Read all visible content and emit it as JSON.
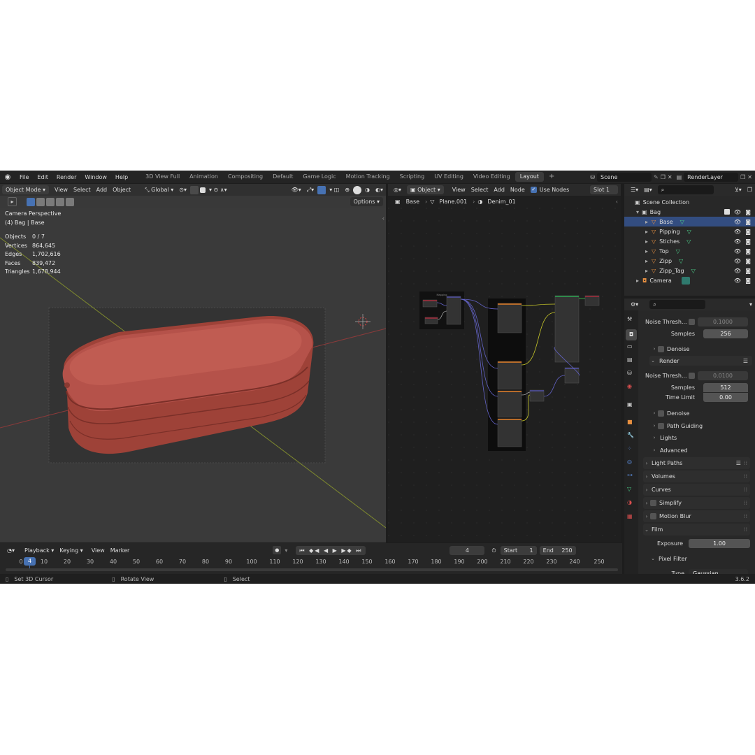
{
  "app": {
    "version": "3.6.2"
  },
  "topbar": {
    "menus": [
      "File",
      "Edit",
      "Render",
      "Window",
      "Help"
    ],
    "workspaces": [
      "3D View Full",
      "Animation",
      "Compositing",
      "Default",
      "Game Logic",
      "Motion Tracking",
      "Scripting",
      "UV Editing",
      "Video Editing",
      "Layout"
    ],
    "active_workspace": "Layout",
    "add": "+",
    "scene": "Scene",
    "view_layer": "RenderLayer"
  },
  "viewport": {
    "mode": "Object Mode",
    "menus": [
      "View",
      "Select",
      "Add",
      "Object"
    ],
    "transform": "Global",
    "options": "Options",
    "overlay": {
      "title": "Camera Perspective",
      "subtitle": "(4) Bag | Base",
      "stats": [
        {
          "label": "Objects",
          "value": "0 / 7"
        },
        {
          "label": "Vertices",
          "value": "864,645"
        },
        {
          "label": "Edges",
          "value": "1,702,616"
        },
        {
          "label": "Faces",
          "value": "839,472"
        },
        {
          "label": "Triangles",
          "value": "1,678,944"
        }
      ]
    },
    "object_color": "#b5524a"
  },
  "node_editor": {
    "type": "Object",
    "menus": [
      "View",
      "Select",
      "Add",
      "Node"
    ],
    "use_nodes": "Use Nodes",
    "slot": "Slot 1",
    "breadcrumb": [
      "Base",
      "Plane.001",
      "Denim_01"
    ],
    "frame_label": "Mapping"
  },
  "outliner": {
    "root": "Scene Collection",
    "collection": "Bag",
    "objects": [
      "Base",
      "Pipping",
      "Stiches",
      "Top",
      "Zipp",
      "Zipp_Tag"
    ],
    "camera": "Camera"
  },
  "properties": {
    "viewport_noise_label": "Noise Thresh...",
    "viewport_noise_value": "0.1000",
    "viewport_samples_label": "Samples",
    "viewport_samples_value": "256",
    "denoise": "Denoise",
    "render": "Render",
    "render_noise_label": "Noise Thresh...",
    "render_noise_value": "0.0100",
    "render_samples_label": "Samples",
    "render_samples_value": "512",
    "time_limit_label": "Time Limit",
    "time_limit_value": "0.00",
    "denoise2": "Denoise",
    "path_guiding": "Path Guiding",
    "lights": "Lights",
    "advanced": "Advanced",
    "light_paths": "Light Paths",
    "volumes": "Volumes",
    "curves": "Curves",
    "simplify": "Simplify",
    "motion_blur": "Motion Blur",
    "film": "Film",
    "exposure_label": "Exposure",
    "exposure_value": "1.00",
    "pixel_filter": "Pixel Filter",
    "type_label": "Type",
    "type_value": "Gaussian"
  },
  "timeline": {
    "menus": [
      "Playback",
      "Keying",
      "View",
      "Marker"
    ],
    "current_frame": "4",
    "start_label": "Start",
    "start": "1",
    "end_label": "End",
    "end": "250",
    "ticks": [
      "0",
      "10",
      "20",
      "30",
      "40",
      "50",
      "60",
      "70",
      "80",
      "90",
      "100",
      "110",
      "120",
      "130",
      "140",
      "150",
      "160",
      "170",
      "180",
      "190",
      "200",
      "210",
      "220",
      "230",
      "240",
      "250"
    ]
  },
  "statusbar": {
    "left": "Set 3D Cursor",
    "middle": "Rotate View",
    "right": "Select"
  }
}
